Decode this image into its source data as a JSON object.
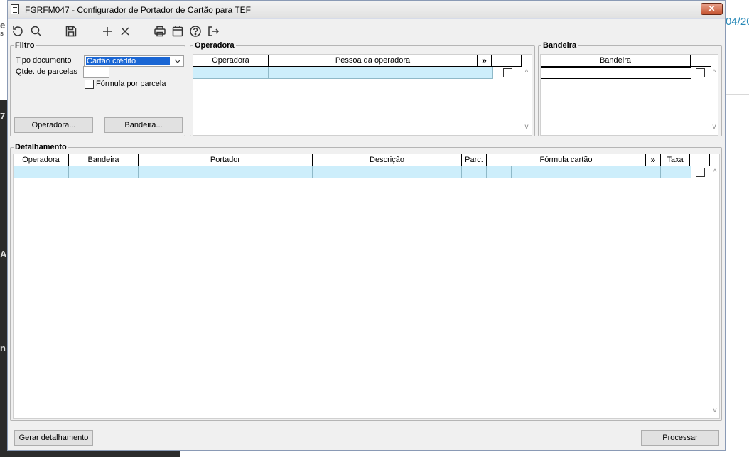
{
  "background": {
    "right_text": "04/20",
    "left_fragments": [
      "e",
      "s",
      "7",
      "A",
      "n"
    ]
  },
  "window": {
    "title": "FGRFM047 - Configurador de Portador de Cartão para TEF",
    "close_symbol": "✕"
  },
  "toolbar": {
    "icons": [
      "refresh-icon",
      "search-icon",
      "save-icon",
      "add-icon",
      "delete-icon",
      "print-icon",
      "calendar-icon",
      "help-icon",
      "exit-icon"
    ]
  },
  "filtro": {
    "title": "Filtro",
    "tipo_documento_label": "Tipo documento",
    "tipo_documento_value": "Cartão crédito",
    "qtde_parcelas_label": "Qtde. de parcelas",
    "qtde_parcelas_value": "",
    "formula_label": "Fórmula por parcela",
    "operadora_button": "Operadora...",
    "bandeira_button": "Bandeira..."
  },
  "operadora": {
    "title": "Operadora",
    "columns": [
      "Operadora",
      "Pessoa da operadora"
    ],
    "more": "»"
  },
  "bandeira": {
    "title": "Bandeira",
    "columns": [
      "Bandeira"
    ]
  },
  "detalhamento": {
    "title": "Detalhamento",
    "columns": [
      "Operadora",
      "Bandeira",
      "Portador",
      "Descrição",
      "Parc.",
      "Fórmula cartão",
      "Taxa"
    ],
    "more": "»"
  },
  "footer": {
    "gerar_button": "Gerar detalhamento",
    "processar_button": "Processar"
  },
  "scroll": {
    "up": "^",
    "down": "v"
  }
}
